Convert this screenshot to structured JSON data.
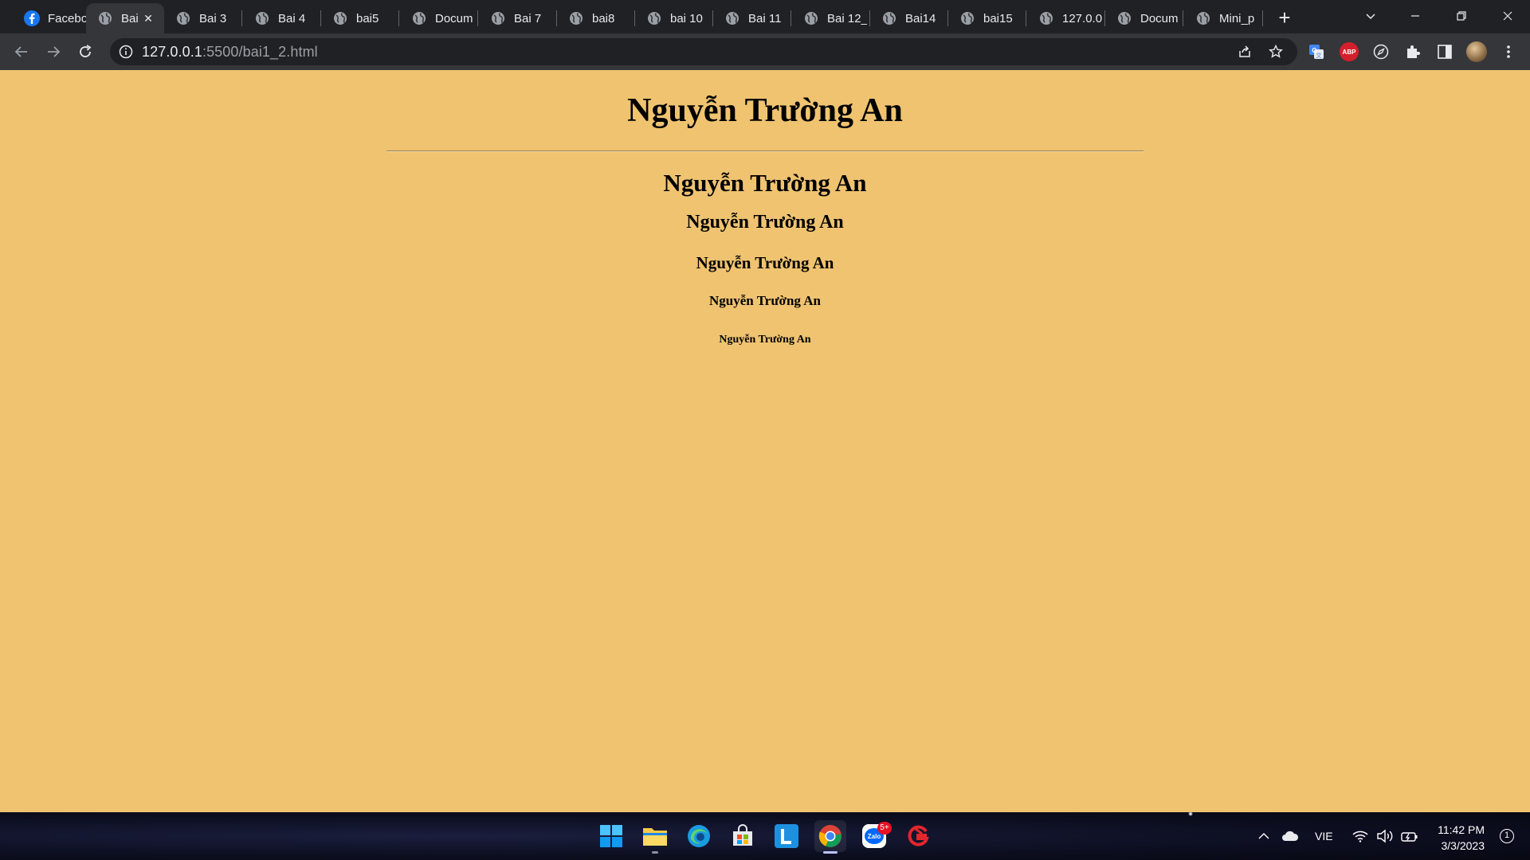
{
  "browser": {
    "tabs": [
      {
        "title": "Faceboo",
        "favicon": "facebook-icon",
        "active": false
      },
      {
        "title": "Bai",
        "favicon": "globe-icon",
        "active": true
      },
      {
        "title": "Bai 3",
        "favicon": "globe-icon",
        "active": false
      },
      {
        "title": "Bai 4",
        "favicon": "globe-icon",
        "active": false
      },
      {
        "title": "bai5",
        "favicon": "globe-icon",
        "active": false
      },
      {
        "title": "Docum",
        "favicon": "globe-icon",
        "active": false
      },
      {
        "title": "Bai 7",
        "favicon": "globe-icon",
        "active": false
      },
      {
        "title": "bai8",
        "favicon": "globe-icon",
        "active": false
      },
      {
        "title": "bai 10",
        "favicon": "globe-icon",
        "active": false
      },
      {
        "title": "Bai 11",
        "favicon": "globe-icon",
        "active": false
      },
      {
        "title": "Bai 12_",
        "favicon": "globe-icon",
        "active": false
      },
      {
        "title": "Bai14",
        "favicon": "globe-icon",
        "active": false
      },
      {
        "title": "bai15",
        "favicon": "globe-icon",
        "active": false
      },
      {
        "title": "127.0.0",
        "favicon": "globe-icon",
        "active": false
      },
      {
        "title": "Docum",
        "favicon": "globe-icon",
        "active": false
      },
      {
        "title": "Mini_p",
        "favicon": "globe-icon",
        "active": false
      }
    ],
    "address": {
      "host": "127.0.0.1",
      "rest": ":5500/bai1_2.html"
    }
  },
  "page": {
    "h1": "Nguyễn Trường An",
    "h2": "Nguyễn Trường An",
    "h3": "Nguyễn Trường An",
    "h4": "Nguyễn Trường An",
    "h5": "Nguyễn Trường An",
    "h6": "Nguyễn Trường An",
    "background_color": "#efc370"
  },
  "taskbar": {
    "zalo_badge": "5+",
    "language": "VIE",
    "time": "11:42 PM",
    "date": "3/3/2023",
    "notifications": "1"
  }
}
